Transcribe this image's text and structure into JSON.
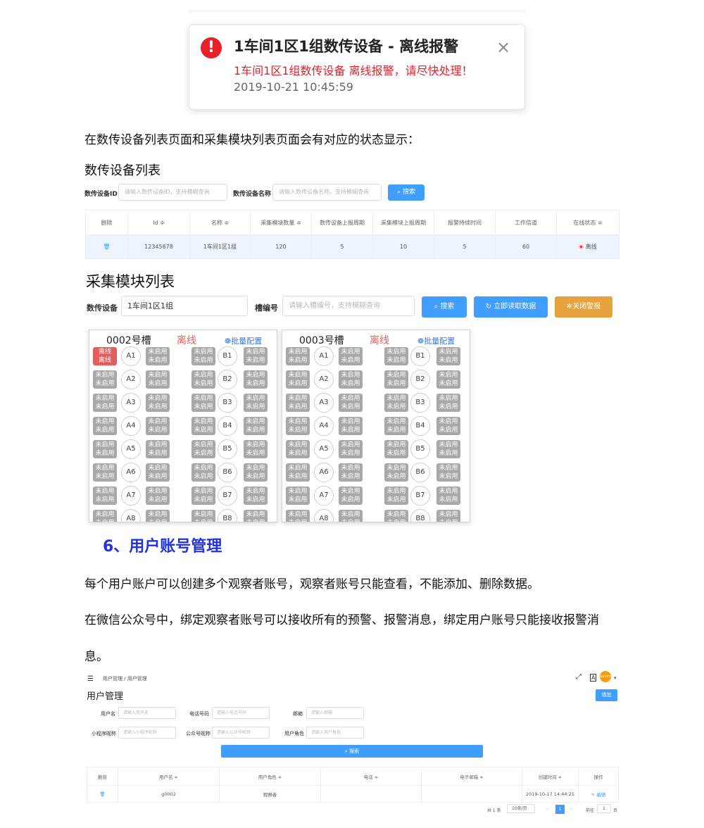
{
  "notification": {
    "icon": "alert-icon",
    "icon_glyph": "!",
    "title": "1车间1区1组数传设备 - 离线报警",
    "message": "1车间1区1组数传设备 离线报警，请尽快处理！",
    "time": "2019-10-21 10:45:59",
    "close_glyph": "×"
  },
  "paragraphs": {
    "status_intro": "在数传设备列表页面和采集模块列表页面会有对应的状态显示：",
    "device_list_heading": "数传设备列表",
    "module_list_heading": "采集模块列表",
    "section_title": "6、用户账号管理",
    "user_para_1": "每个用户账户可以创建多个观察者账号，观察者账号只能查看，不能添加、删除数据。",
    "user_para_2a": "在微信公众号中，绑定观察者账号可以接收所有的预警、报警消息，绑定用户账号只能接收报警消",
    "user_para_2b": "息。"
  },
  "device_list": {
    "filter_id_label": "数传设备ID",
    "filter_id_placeholder": "请输入数传设备ID，支持模糊查询",
    "filter_name_label": "数传设备名称",
    "filter_name_placeholder": "请输入数传设备名称，支持模糊查询",
    "search_label": "搜索",
    "columns": [
      "删除",
      "Id ≑",
      "名称 ≑",
      "采集模块数量 ≑",
      "数传设备上报周期",
      "采集模块上报周期",
      "报警持续时间",
      "工作信道",
      "在线状态 ≑"
    ],
    "row": {
      "delete_icon": "trash-icon",
      "delete_glyph": "🗑",
      "id": "12345678",
      "name": "1车间1区1组",
      "module_count": "120",
      "device_period": "5",
      "module_period": "10",
      "alarm_duration": "5",
      "channel": "60",
      "status": "离线",
      "status_color": "#e8202a"
    }
  },
  "module_list": {
    "device_label": "数传设备",
    "device_value": "1车间1区1组",
    "slot_label": "槽编号",
    "slot_placeholder": "请输入槽编号，支持模糊查询",
    "search_label": "搜索",
    "read_label": "立即读取数据",
    "close_alarm_label": "关闭警报",
    "colors": {
      "blue": "#409eff",
      "orange": "#e6a23c",
      "offline_chip": "#e35e5e",
      "disabled_chip": "#a8a8a8"
    },
    "panels": [
      {
        "name": "0002号槽",
        "status": "离线",
        "config_label": "批量配置",
        "slots": [
          "A1",
          "A2",
          "A3",
          "A4",
          "A5",
          "A6",
          "A7",
          "A8"
        ],
        "right_slots": [
          "B1",
          "B2",
          "B3",
          "B4",
          "B5",
          "B6",
          "B7",
          "B8"
        ],
        "first_chip_line1": "离线",
        "first_chip_line2": "离线",
        "chip_line1": "未启用",
        "chip_line2": "未启用"
      },
      {
        "name": "0003号槽",
        "status": "离线",
        "config_label": "批量配置",
        "slots": [
          "A1",
          "A2",
          "A3",
          "A4",
          "A5",
          "A6",
          "A7",
          "A8"
        ],
        "right_slots": [
          "B1",
          "B2",
          "B3",
          "B4",
          "B5",
          "B6",
          "B7",
          "B8"
        ],
        "first_chip_line1": "未启用",
        "first_chip_line2": "未启用",
        "chip_line1": "未启用",
        "chip_line2": "未启用"
      }
    ]
  },
  "user_mgmt": {
    "breadcrumb": "用户管理 / 用户管理",
    "title": "用户管理",
    "add_label": "增加",
    "avatar_text": "admin",
    "filters": [
      {
        "label": "用户名",
        "placeholder": "请输入用户名"
      },
      {
        "label": "电话号码",
        "placeholder": "请输入电话号码"
      },
      {
        "label": "邮箱",
        "placeholder": "请输入邮箱"
      },
      {
        "label": "小程序昵称",
        "placeholder": "请输入小程序昵称"
      },
      {
        "label": "公众号昵称",
        "placeholder": "请输入公众号昵称"
      },
      {
        "label": "用户角色",
        "placeholder": "请输入用户角色"
      }
    ],
    "search_label": "搜索",
    "columns": [
      "删除",
      "用户名 ≑",
      "用户角色 ≑",
      "电话 ≑",
      "电子邮箱 ≑",
      "创建时间 ≑",
      "操作"
    ],
    "row": {
      "username": "g0002",
      "role": "观察者",
      "phone": "",
      "email": "",
      "created": "2019-10-17 14:44:25",
      "action": "编辑"
    },
    "pagination": {
      "total": "共 1 条",
      "page_size": "10条/页",
      "current": "1",
      "goto_label": "前往",
      "goto_value": "1",
      "page_suffix": "页"
    }
  }
}
